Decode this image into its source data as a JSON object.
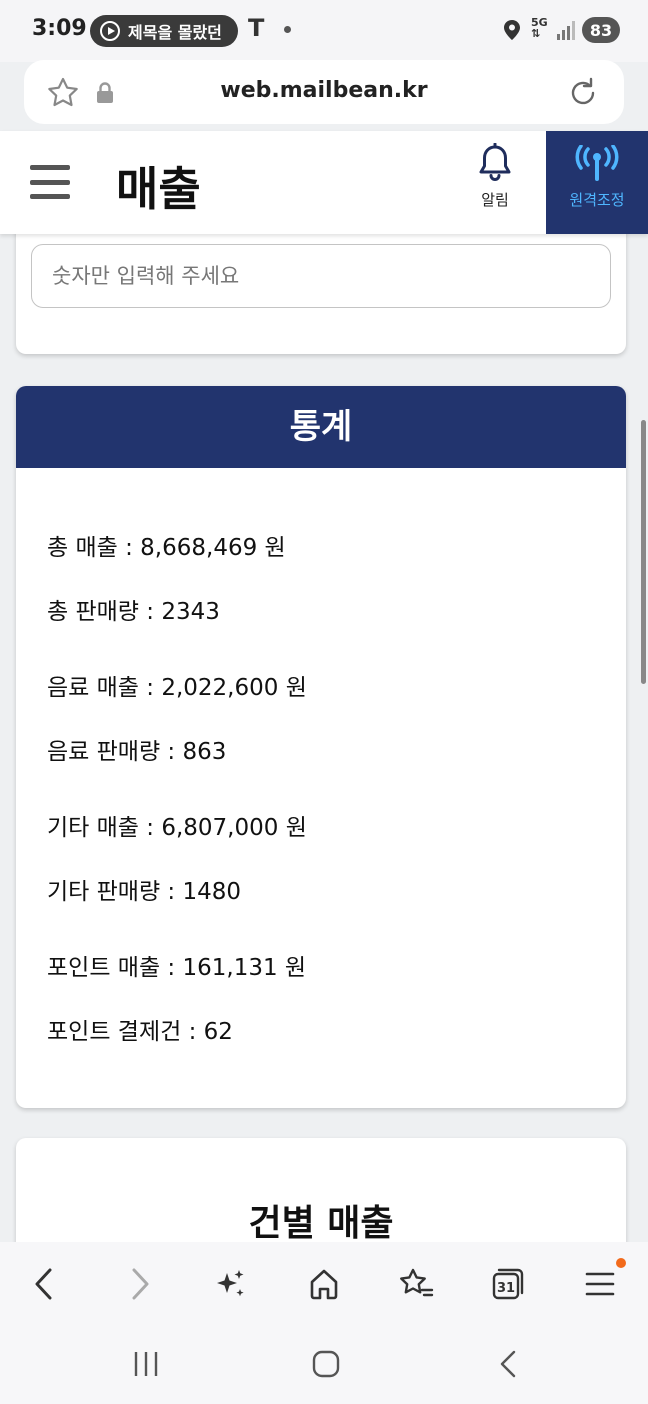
{
  "status_bar": {
    "time": "3:09",
    "media_title": "제목을 몰랐던",
    "carrier_mark": "T",
    "network": "5G",
    "battery": "83"
  },
  "browser": {
    "url": "web.mailbean.kr"
  },
  "header": {
    "title": "매출",
    "alarm_label": "알림",
    "remote_label": "원격조정"
  },
  "input_card": {
    "placeholder": "숫자만 입력해 주세요",
    "value": ""
  },
  "stats": {
    "title": "통계",
    "lines": [
      "총 매출 : 8,668,469 원",
      "총 판매량 : 2343",
      "음료 매출 : 2,022,600 원",
      "음료 판매량 : 863",
      "기타 매출 : 6,807,000 원",
      "기타 판매량 : 1480",
      "포인트 매출 : 161,131 원",
      "포인트 결제건 : 62"
    ]
  },
  "detail": {
    "title": "건별 매출"
  },
  "toolbar": {
    "tabs_count": "31"
  },
  "colors": {
    "accent": "#22346e",
    "remote_text": "#4fb6ff",
    "notification_dot": "#f26a1b"
  }
}
